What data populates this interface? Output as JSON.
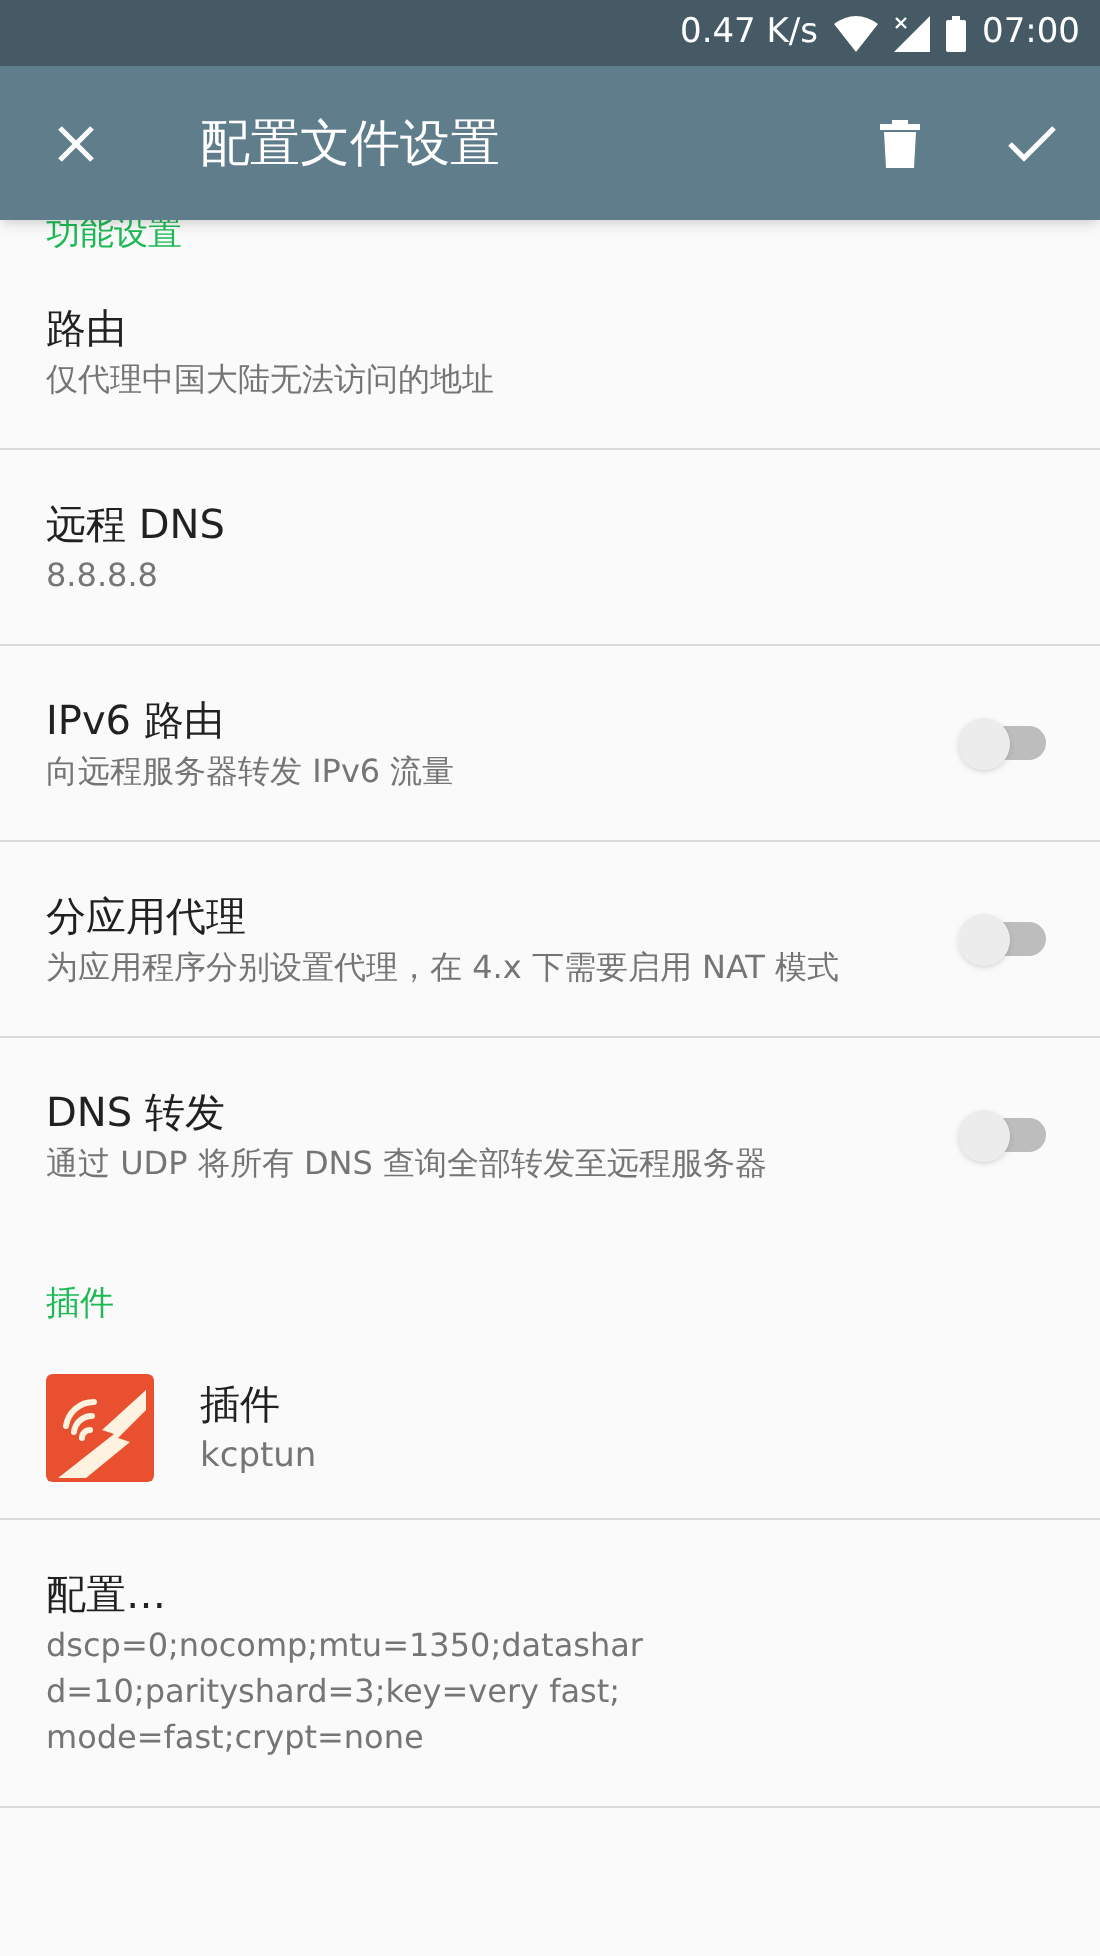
{
  "status_bar": {
    "speed": "0.47 K/s",
    "time": "07:00"
  },
  "app_bar": {
    "title": "配置文件设置"
  },
  "sections": [
    {
      "header": "功能设置",
      "items": [
        {
          "kind": "text",
          "title": "路由",
          "summary": "仅代理中国大陆无法访问的地址"
        },
        {
          "kind": "text",
          "title": "远程 DNS",
          "summary": "8.8.8.8"
        },
        {
          "kind": "switch",
          "title": "IPv6 路由",
          "summary": "向远程服务器转发 IPv6 流量",
          "on": false
        },
        {
          "kind": "switch",
          "title": "分应用代理",
          "summary": "为应用程序分别设置代理，在 4.x 下需要启用 NAT 模式",
          "on": false
        },
        {
          "kind": "switch",
          "title": "DNS 转发",
          "summary": "通过 UDP 将所有 DNS 查询全部转发至远程服务器",
          "on": false
        }
      ]
    },
    {
      "header": "插件",
      "items": [
        {
          "kind": "plugin",
          "title": "插件",
          "summary": "kcptun"
        },
        {
          "kind": "text",
          "title": "配置…",
          "summary": "dscp=0;nocomp;mtu=1350;datashard=10;parityshard=3;key=very fast;mode=fast;crypt=none"
        }
      ]
    }
  ]
}
